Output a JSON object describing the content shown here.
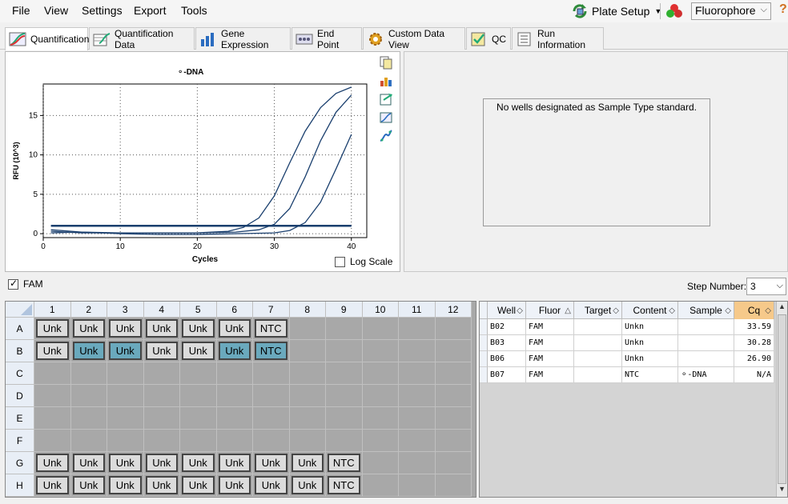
{
  "menu": [
    "File",
    "View",
    "Settings",
    "Export",
    "Tools"
  ],
  "toolbar": {
    "plate_setup": "Plate Setup",
    "fluorophore": "Fluorophore",
    "help": "?"
  },
  "tabs": [
    "Quantification",
    "Quantification Data",
    "Gene Expression",
    "End Point",
    "Custom Data View",
    "QC",
    "Run Information"
  ],
  "chart_data": {
    "type": "line",
    "title": "⚬-DNA",
    "xlabel": "Cycles",
    "ylabel": "RFU (10^3)",
    "xlim": [
      0,
      42
    ],
    "ylim": [
      -0.5,
      19
    ],
    "x_ticks": [
      0,
      10,
      20,
      30,
      40
    ],
    "y_ticks": [
      0,
      5,
      10,
      15
    ],
    "grid": true,
    "series": [
      {
        "x": [
          1,
          5,
          10,
          15,
          20,
          24,
          26,
          28,
          30,
          32,
          34,
          36,
          38,
          40
        ],
        "y": [
          0.1,
          0.2,
          0.1,
          0.1,
          0.1,
          0.3,
          0.8,
          2.0,
          4.8,
          9.0,
          13.0,
          16.0,
          17.8,
          18.6
        ]
      },
      {
        "x": [
          1,
          5,
          10,
          15,
          20,
          25,
          28,
          30,
          32,
          34,
          36,
          38,
          40
        ],
        "y": [
          0.3,
          0.1,
          0.1,
          0.1,
          0.1,
          0.2,
          0.5,
          1.2,
          3.2,
          7.2,
          11.8,
          15.4,
          17.6
        ]
      },
      {
        "x": [
          1,
          5,
          10,
          15,
          20,
          25,
          30,
          32,
          34,
          36,
          38,
          40
        ],
        "y": [
          0.5,
          0.2,
          0.0,
          -0.1,
          -0.1,
          0.0,
          0.1,
          0.4,
          1.4,
          4.0,
          8.2,
          12.6
        ]
      },
      {
        "x": [
          1,
          5,
          10,
          15,
          20,
          25,
          30,
          35,
          40
        ],
        "y": [
          1.0,
          1.0,
          1.0,
          1.0,
          1.0,
          1.0,
          1.0,
          1.0,
          1.0
        ]
      }
    ]
  },
  "chart": {
    "log_scale_label": "Log Scale",
    "color": "#1a3f6e"
  },
  "standard_panel": {
    "message": "No wells designated as Sample Type standard."
  },
  "fam_label": "FAM",
  "step": {
    "label": "Step Number:",
    "value": "3"
  },
  "plate": {
    "columns": [
      "1",
      "2",
      "3",
      "4",
      "5",
      "6",
      "7",
      "8",
      "9",
      "10",
      "11",
      "12"
    ],
    "rows": [
      {
        "label": "A",
        "wells": [
          "Unk",
          "Unk",
          "Unk",
          "Unk",
          "Unk",
          "Unk",
          "NTC",
          "",
          "",
          "",
          "",
          ""
        ],
        "selected": [
          false,
          false,
          false,
          false,
          false,
          false,
          false,
          false,
          false,
          false,
          false,
          false
        ]
      },
      {
        "label": "B",
        "wells": [
          "Unk",
          "Unk",
          "Unk",
          "Unk",
          "Unk",
          "Unk",
          "NTC",
          "",
          "",
          "",
          "",
          ""
        ],
        "selected": [
          false,
          true,
          true,
          false,
          false,
          true,
          true,
          false,
          false,
          false,
          false,
          false
        ]
      },
      {
        "label": "C",
        "wells": [
          "",
          "",
          "",
          "",
          "",
          "",
          "",
          "",
          "",
          "",
          "",
          ""
        ],
        "selected": []
      },
      {
        "label": "D",
        "wells": [
          "",
          "",
          "",
          "",
          "",
          "",
          "",
          "",
          "",
          "",
          "",
          ""
        ],
        "selected": []
      },
      {
        "label": "E",
        "wells": [
          "",
          "",
          "",
          "",
          "",
          "",
          "",
          "",
          "",
          "",
          "",
          ""
        ],
        "selected": []
      },
      {
        "label": "F",
        "wells": [
          "",
          "",
          "",
          "",
          "",
          "",
          "",
          "",
          "",
          "",
          "",
          ""
        ],
        "selected": []
      },
      {
        "label": "G",
        "wells": [
          "Unk",
          "Unk",
          "Unk",
          "Unk",
          "Unk",
          "Unk",
          "Unk",
          "Unk",
          "NTC",
          "",
          "",
          ""
        ],
        "selected": []
      },
      {
        "label": "H",
        "wells": [
          "Unk",
          "Unk",
          "Unk",
          "Unk",
          "Unk",
          "Unk",
          "Unk",
          "Unk",
          "NTC",
          "",
          "",
          ""
        ],
        "selected": []
      }
    ]
  },
  "table": {
    "headers": [
      "Well",
      "Fluor",
      "Target",
      "Content",
      "Sample",
      "Cq"
    ],
    "rows": [
      [
        "B02",
        "FAM",
        "",
        "Unkn",
        "",
        "33.59"
      ],
      [
        "B03",
        "FAM",
        "",
        "Unkn",
        "",
        "30.28"
      ],
      [
        "B06",
        "FAM",
        "",
        "Unkn",
        "",
        "26.90"
      ],
      [
        "B07",
        "FAM",
        "",
        "NTC",
        "⚬-DNA",
        "N/A"
      ]
    ]
  }
}
